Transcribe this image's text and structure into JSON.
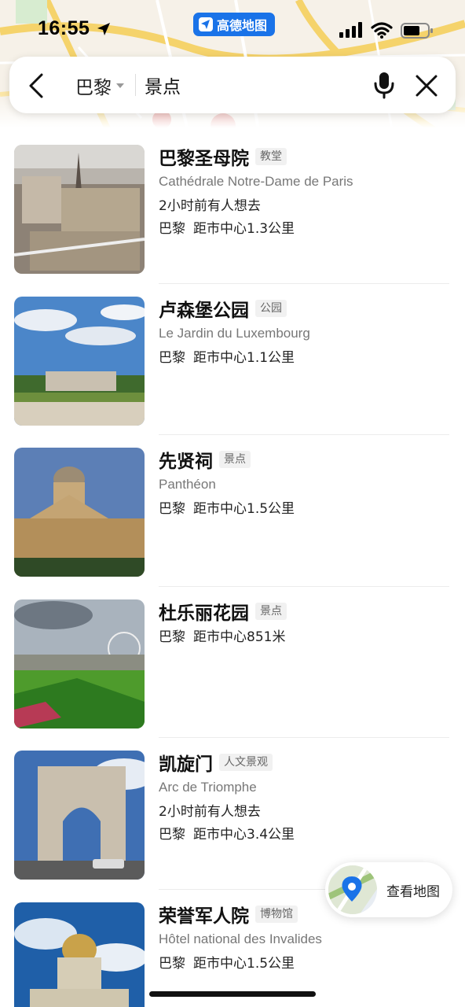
{
  "status_bar": {
    "time": "16:55",
    "app_badge": "高德地图",
    "icons": [
      "location-arrow-icon",
      "signal-icon",
      "wifi-icon",
      "battery-icon"
    ]
  },
  "search": {
    "city": "巴黎",
    "query": "景点",
    "icons": [
      "back-icon",
      "caret-down-icon",
      "microphone-icon",
      "close-icon"
    ]
  },
  "results": [
    {
      "name": "巴黎圣母院",
      "tag": "教堂",
      "subtitle": "Cathédrale Notre-Dame de Paris",
      "recent": "2小时前有人想去",
      "city": "巴黎",
      "distance": "距市中心1.3公里"
    },
    {
      "name": "卢森堡公园",
      "tag": "公园",
      "subtitle": "Le Jardin du Luxembourg",
      "recent": "",
      "city": "巴黎",
      "distance": "距市中心1.1公里"
    },
    {
      "name": "先贤祠",
      "tag": "景点",
      "subtitle": "Panthéon",
      "recent": "",
      "city": "巴黎",
      "distance": "距市中心1.5公里"
    },
    {
      "name": "杜乐丽花园",
      "tag": "景点",
      "subtitle": "",
      "recent": "",
      "city": "巴黎",
      "distance": "距市中心851米"
    },
    {
      "name": "凯旋门",
      "tag": "人文景观",
      "subtitle": "Arc de Triomphe",
      "recent": "2小时前有人想去",
      "city": "巴黎",
      "distance": "距市中心3.4公里"
    },
    {
      "name": "荣誉军人院",
      "tag": "博物馆",
      "subtitle": "Hôtel national des Invalides",
      "recent": "",
      "city": "巴黎",
      "distance": "距市中心1.5公里"
    }
  ],
  "view_map": {
    "label": "查看地图",
    "icon": "map-pin-icon"
  },
  "colors": {
    "accent": "#1a73e8",
    "text_primary": "#111111",
    "text_secondary": "#777777",
    "tag_bg": "#f1f1f1"
  }
}
